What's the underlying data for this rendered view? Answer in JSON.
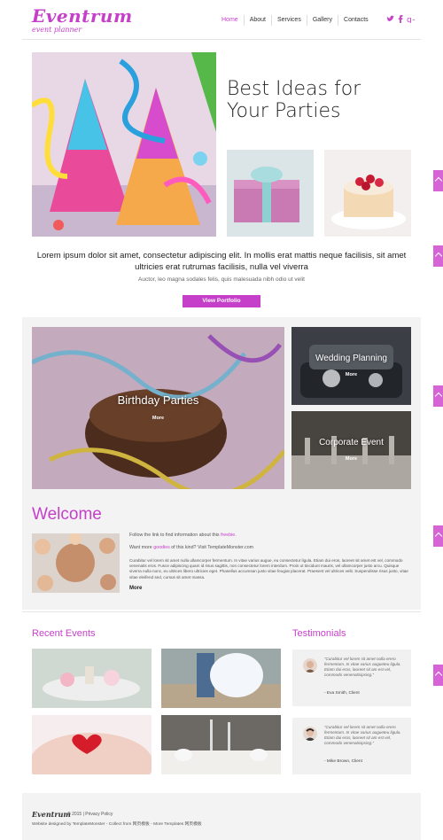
{
  "header": {
    "logo": "Eventrum",
    "tagline": "event planner",
    "nav": [
      "Home",
      "About",
      "Services",
      "Gallery",
      "Contacts"
    ],
    "social_icons": [
      "twitter-icon",
      "facebook-icon",
      "google-plus-icon"
    ],
    "accent": "#c63fc9"
  },
  "hero": {
    "title_line1": "Best Ideas for",
    "title_line2": "Your Parties",
    "lead": "Lorem ipsum dolor sit amet, consectetur adipiscing elit. In mollis erat mattis neque facilisis, sit amet ultricies erat rutrumas facilisis, nulla vel viverra",
    "sub": "Auctor, leo magna sodales felis, quis malesuada nibh odio ut velit",
    "button": "View Portfolio"
  },
  "gallery": {
    "tiles": [
      {
        "caption": "Birthday Parties",
        "more": "More"
      },
      {
        "caption": "Wedding Planning",
        "more": "More"
      },
      {
        "caption": "Corporate Event",
        "more": "More"
      }
    ]
  },
  "welcome": {
    "title": "Welcome",
    "line1_prefix": "Follow the link to find information about this ",
    "line1_link": "freebie",
    "line1_suffix": ".",
    "line2_prefix": "Want more ",
    "line2_link": "goodies",
    "line2_suffix": " of this kind? Visit TemplateMonster.com",
    "body": "Curabitur vel lorem sit amet nulla ullamcorper fermentum. In vitae varius augue, eu consectetur ligula. Etiam dui eros, laoreet sit amet est vel, commodo venenatis eros. Fusce adipiscing quam id risus sagittis, non consectetur lorem interdum. Proin ut tincidunt mauris, vel ullamcorper justo arcu. Quisque viverra nulla nunc, eu ultrices libero ultricies eget. Phasellus accumsan justo vitae feugiat placerat. Praesent vel ultrices velit. Suspendisse risus justo, vitae vitae eleifend sed, cursus sit amet massa.",
    "more": "More"
  },
  "recent": {
    "title": "Recent Events"
  },
  "testimonials": {
    "title": "Testimonials",
    "items": [
      {
        "quote": "“Curabitur vel lorem sit amet nulla erero fermentum. In vitae varius augueteu ligula. Etiam dui eros, laoreet sit am est vel, commodo venenatisipsing.”",
        "author": "- Eva Smith, Client"
      },
      {
        "quote": "“Curabitur vel lorem sit amet nulla erero fermentum. In vitae varius augueteu ligula. Etiam dui eros, laoreet sit am est vel, commodo venenatisipsing.”",
        "author": "- Mike Brown, Client"
      }
    ]
  },
  "footer": {
    "logo": "Eventrum",
    "copy": "© 2015 | Privacy Policy",
    "credit": "Website designed by TemplateMonster - Collect from 网页模板 - More Templates 网页模板"
  }
}
